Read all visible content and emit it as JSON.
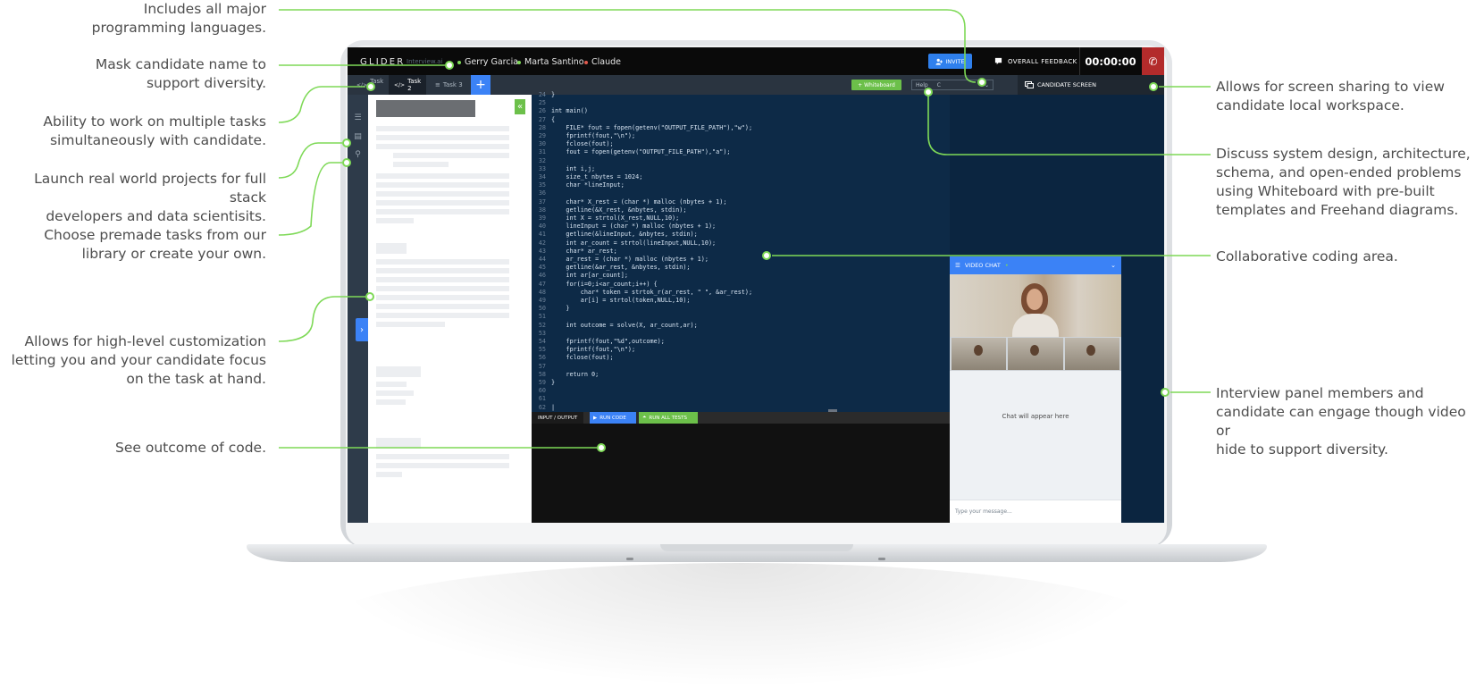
{
  "callouts_left": [
    {
      "text": "Includes all major\nprogramming languages."
    },
    {
      "text": "Mask candidate name to\nsupport diversity."
    },
    {
      "text": "Ability to work on multiple tasks\nsimultaneously with candidate."
    },
    {
      "text": "Launch real world projects for full stack\ndevelopers and data scientisits."
    },
    {
      "text": "Choose premade tasks from our\nlibrary or create your own."
    },
    {
      "text": "Allows for high-level customization\nletting you and your candidate focus\non the task at hand."
    },
    {
      "text": "See outcome of code."
    }
  ],
  "callouts_right": [
    {
      "text": "Allows for screen sharing to view\ncandidate local workspace."
    },
    {
      "text": "Discuss system design, architecture,\nschema, and open-ended problems\nusing Whiteboard with pre-built\ntemplates and Freehand diagrams."
    },
    {
      "text": "Collaborative coding area."
    },
    {
      "text": "Interview panel members and\ncandidate can engage though video or\nhide to support diversity."
    }
  ],
  "app": {
    "logo": "GLIDER",
    "logo_sub": "Interview.ai",
    "participants": [
      {
        "name": "Gerry Garcia",
        "dot_color": "#7ed957"
      },
      {
        "name": "Marta Santino",
        "dot_color": "#7ed957"
      },
      {
        "name": "Claude",
        "dot_color": "#e05a4e"
      }
    ],
    "invite_label": "INVITE",
    "feedback_label": "OVERALL FEEDBACK",
    "timer": "00:00:00",
    "accent": "#3b82f6",
    "green": "#6cc04a",
    "danger": "#b32b2b"
  },
  "tabs": [
    {
      "label": "Task 1",
      "icon": "code-icon"
    },
    {
      "label": "Task 2",
      "icon": "code-icon",
      "active": true
    },
    {
      "label": "Task 3",
      "icon": "list-icon"
    }
  ],
  "toolbar": {
    "add_tab": "+",
    "whiteboard_label": "+ Whiteboard",
    "help_label": "Help",
    "language": "C",
    "candidate_screen_label": "CANDIDATE SCREEN"
  },
  "code": {
    "lines": [
      {
        "n": "24",
        "t": "}"
      },
      {
        "n": "25",
        "t": ""
      },
      {
        "n": "26",
        "t": "int main()"
      },
      {
        "n": "27",
        "t": "{"
      },
      {
        "n": "28",
        "t": "    FILE* fout = fopen(getenv(\"OUTPUT_FILE_PATH\"),\"w\");"
      },
      {
        "n": "29",
        "t": "    fprintf(fout,\"\\n\");"
      },
      {
        "n": "30",
        "t": "    fclose(fout);"
      },
      {
        "n": "31",
        "t": "    fout = fopen(getenv(\"OUTPUT_FILE_PATH\"),\"a\");"
      },
      {
        "n": "32",
        "t": ""
      },
      {
        "n": "33",
        "t": "    int i,j;"
      },
      {
        "n": "34",
        "t": "    size_t nbytes = 1024;"
      },
      {
        "n": "35",
        "t": "    char *lineInput;"
      },
      {
        "n": "36",
        "t": ""
      },
      {
        "n": "37",
        "t": "    char* X_rest = (char *) malloc (nbytes + 1);"
      },
      {
        "n": "38",
        "t": "    getline(&X_rest, &nbytes, stdin);"
      },
      {
        "n": "39",
        "t": "    int X = strtol(X_rest,NULL,10);"
      },
      {
        "n": "40",
        "t": "    lineInput = (char *) malloc (nbytes + 1);"
      },
      {
        "n": "41",
        "t": "    getline(&lineInput, &nbytes, stdin);"
      },
      {
        "n": "42",
        "t": "    int ar_count = strtol(lineInput,NULL,10);"
      },
      {
        "n": "43",
        "t": "    char* ar_rest;"
      },
      {
        "n": "44",
        "t": "    ar_rest = (char *) malloc (nbytes + 1);"
      },
      {
        "n": "45",
        "t": "    getline(&ar_rest, &nbytes, stdin);"
      },
      {
        "n": "46",
        "t": "    int ar[ar_count];"
      },
      {
        "n": "47",
        "t": "    for(i=0;i<ar_count;i++) {"
      },
      {
        "n": "48",
        "t": "        char* token = strtok_r(ar_rest, \" \", &ar_rest);"
      },
      {
        "n": "49",
        "t": "        ar[i] = strtol(token,NULL,10);"
      },
      {
        "n": "50",
        "t": "    }"
      },
      {
        "n": "51",
        "t": ""
      },
      {
        "n": "52",
        "t": "    int outcome = solve(X, ar_count,ar);"
      },
      {
        "n": "53",
        "t": ""
      },
      {
        "n": "54",
        "t": "    fprintf(fout,\"%d\",outcome);"
      },
      {
        "n": "55",
        "t": "    fprintf(fout,\"\\n\");"
      },
      {
        "n": "56",
        "t": "    fclose(fout);"
      },
      {
        "n": "57",
        "t": ""
      },
      {
        "n": "58",
        "t": "    return 0;"
      },
      {
        "n": "59",
        "t": "}"
      },
      {
        "n": "60",
        "t": ""
      },
      {
        "n": "61",
        "t": ""
      },
      {
        "n": "62",
        "t": "|"
      }
    ]
  },
  "io": {
    "tab_label": "INPUT / OUTPUT",
    "run_code_label": "RUN CODE",
    "run_all_label": "RUN ALL TESTS"
  },
  "video": {
    "header_label": "VIDEO CHAT",
    "chat_placeholder": "Chat will appear here",
    "input_placeholder": "Type your message..."
  }
}
